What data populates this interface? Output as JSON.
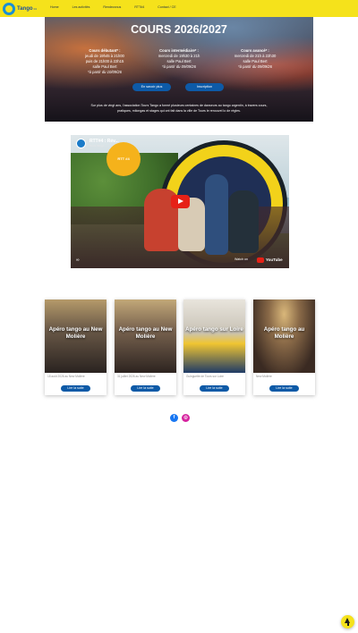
{
  "header": {
    "logo_text": "Tango",
    "logo_sup": "04",
    "nav": [
      "Home",
      "Les activités",
      "Rendezvous",
      "RTT#4",
      "Contact / CE"
    ]
  },
  "hero": {
    "title": "COURS 2026/2027",
    "courses": [
      {
        "title": "Cours débutant* :",
        "lines": [
          "jeudi de 19h45 à 21h00",
          "puis de 21h00 à 22h15",
          "salle Paul Bert"
        ],
        "note": "*à partir du 10/09/26"
      },
      {
        "title": "Cours intermédiaire* :",
        "lines": [
          "mercredi de 19h30 à 21h",
          "salle Paul Bert"
        ],
        "note": "*à partir du 09/09/26"
      },
      {
        "title": "Cours avancé* :",
        "lines": [
          "mercredi de 21h à 22h30",
          "salle Paul Bert"
        ],
        "note": "*à partir du 09/09/26"
      }
    ],
    "buttons": {
      "more": "En savoir plus",
      "signup": "Inscription"
    },
    "description_line1": "Sur plus de vingt ans, l'association Tours Tango a formé plusieurs centaines de danseurs au tango argentin, à travers cours,",
    "description_line2": "pratiques, milongas et stages qui ont fait dans la ville de Tours le renouvel lo de règles."
  },
  "video": {
    "title": "RTT#4 : Rév...",
    "channel": "Tours Tango",
    "badge": "RTT #4",
    "watch_on": "Watch on",
    "yt": "YouTube",
    "cc": "∞"
  },
  "cards": [
    {
      "title": "Apéro tango au New Molière",
      "meta": "18 août 2026 au New Molière",
      "button": "Lire la suite"
    },
    {
      "title": "Apéro tango au New Molière",
      "meta": "31 juillet 2026 au New Molière",
      "button": "Lire la suite"
    },
    {
      "title": "Apéro tango sur Loire",
      "meta": "Guinguette de Tours sur Loire",
      "button": "Lire la suite"
    },
    {
      "title": "Apéro tango au Molière",
      "meta": "New Molière",
      "button": "Lire la suite"
    }
  ],
  "social": {
    "facebook": "f",
    "instagram": "◎"
  },
  "colors": {
    "accent_yellow": "#f5e21b",
    "button_blue": "#0d5aa7"
  }
}
